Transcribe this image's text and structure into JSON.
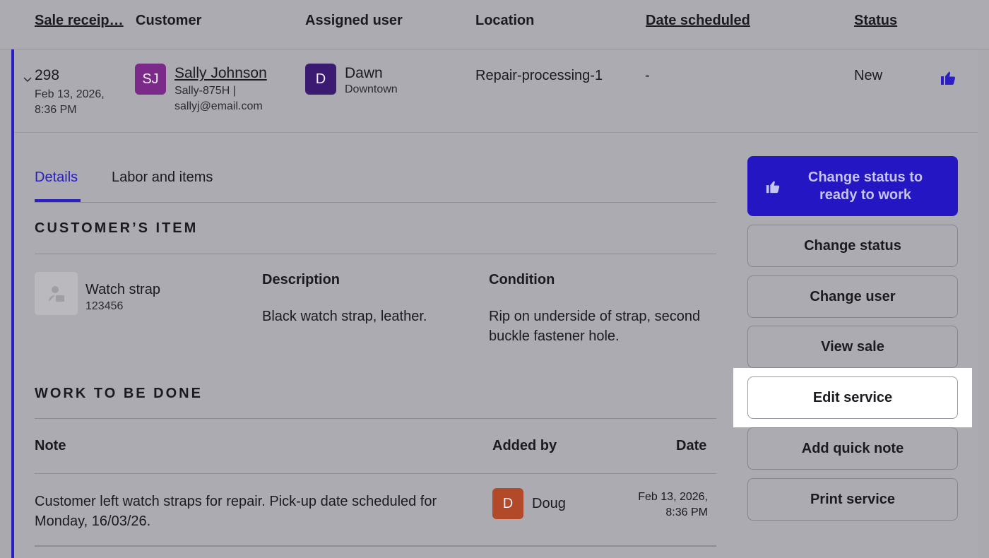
{
  "table_header": {
    "sale_receipt": "Sale receip…",
    "customer": "Customer",
    "assigned_user": "Assigned user",
    "location": "Location",
    "date_scheduled": "Date scheduled",
    "status": "Status"
  },
  "sale": {
    "receipt_number": "298",
    "receipt_datetime": "Feb 13, 2026, 8:36 PM",
    "customer": {
      "initials": "SJ",
      "name": "Sally Johnson",
      "details": "Sally-875H | sallyj@email.com"
    },
    "assigned_user": {
      "initial": "D",
      "name": "Dawn",
      "location": "Downtown"
    },
    "location": "Repair-processing-1",
    "date_scheduled": "-",
    "status": "New"
  },
  "tabs": {
    "details": "Details",
    "labor_items": "Labor and items"
  },
  "customers_item": {
    "section_title": "CUSTOMER’S ITEM",
    "item_name": "Watch strap",
    "item_sku": "123456",
    "description_label": "Description",
    "description": "Black watch strap, leather.",
    "condition_label": "Condition",
    "condition": "Rip on underside of strap, second buckle fastener hole."
  },
  "work": {
    "section_title": "WORK TO BE DONE",
    "headers": {
      "note": "Note",
      "added_by": "Added by",
      "date": "Date"
    },
    "rows": [
      {
        "note": "Customer left watch straps for repair. Pick-up date scheduled for Monday, 16/03/26.",
        "added_by_initial": "D",
        "added_by": "Doug",
        "date": "Feb 13, 2026, 8:36 PM"
      }
    ]
  },
  "actions": {
    "primary": "Change status to ready to work",
    "change_status": "Change status",
    "change_user": "Change user",
    "view_sale": "View sale",
    "edit_service": "Edit service",
    "add_quick_note": "Add quick note",
    "print_service": "Print service"
  },
  "colors": {
    "accent": "#2516c3",
    "avatar_customer": "#7b2a8a",
    "avatar_user": "#3b1b72",
    "avatar_doug": "#b24a2a"
  },
  "icons": {
    "status_icon": "thumbs-up-icon",
    "expand_icon": "chevron-down-icon",
    "item_placeholder_icon": "item-placeholder-icon"
  }
}
